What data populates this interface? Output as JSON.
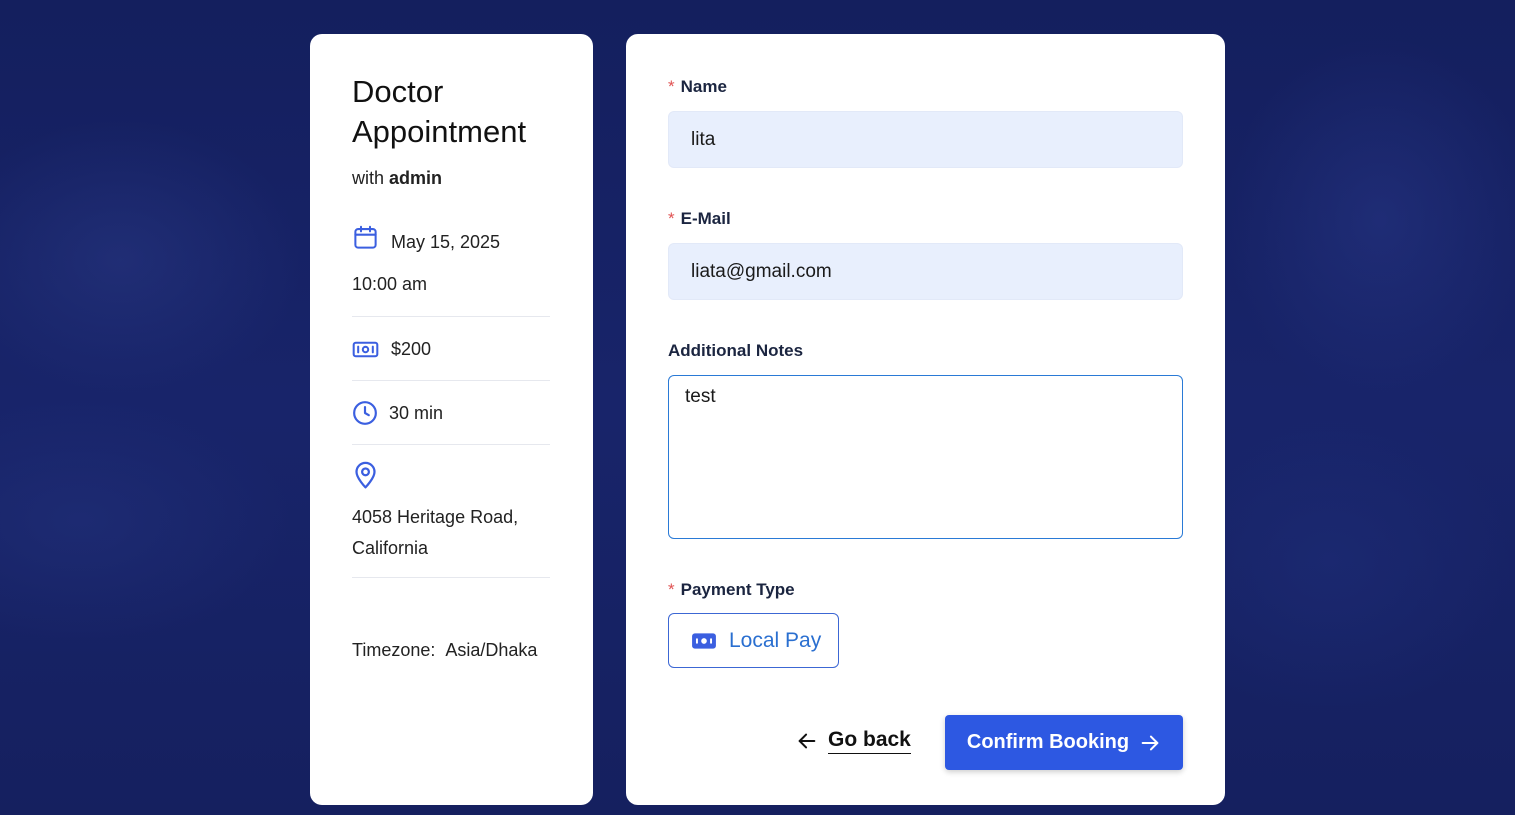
{
  "summary": {
    "title": "Doctor Appointment",
    "host_prefix": "with",
    "host_name": "admin",
    "date": "May 15, 2025",
    "time": "10:00 am",
    "price": "$200",
    "duration": "30 min",
    "location_line1": "4058 Heritage Road,",
    "location_line2": "California",
    "timezone_label": "Timezone:",
    "timezone_value": "Asia/Dhaka",
    "icons": {
      "date": "calendar-icon",
      "price": "money-icon",
      "duration": "clock-icon",
      "location": "map-pin-icon"
    },
    "accent_color": "#2d58e2"
  },
  "form": {
    "required_marker": "*",
    "name_label": "Name",
    "name_value": "lita",
    "email_label": "E-Mail",
    "email_value": "liata@gmail.com",
    "notes_label": "Additional Notes",
    "notes_value": "test",
    "payment_label": "Payment Type",
    "payment_option": "Local Pay",
    "go_back_label": "Go back",
    "confirm_label": "Confirm Booking"
  }
}
